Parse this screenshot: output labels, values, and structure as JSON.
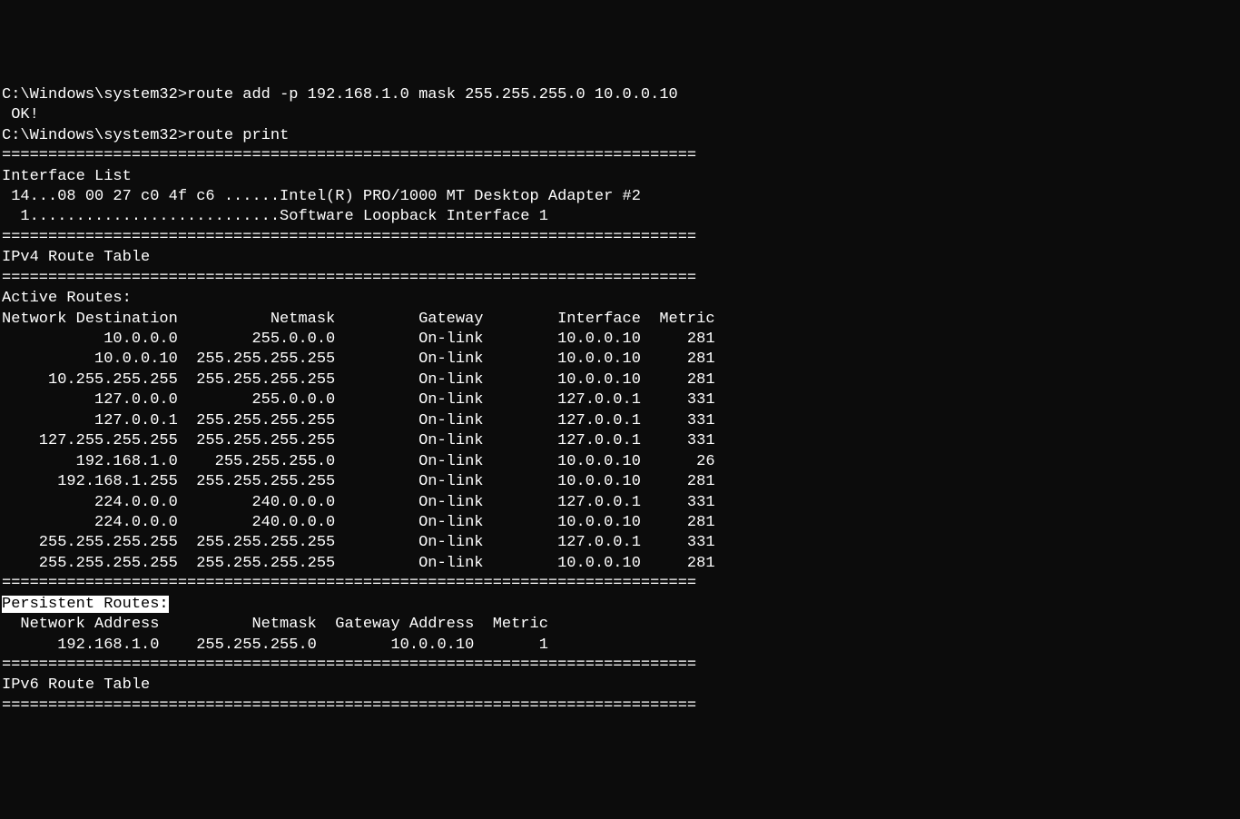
{
  "commands": [
    {
      "prompt": "C:\\Windows\\system32>",
      "cmd": "route add -p 192.168.1.0 mask 255.255.255.0 10.0.0.10"
    },
    {
      "prompt": "C:\\Windows\\system32>",
      "cmd": "route print"
    }
  ],
  "ok_line": " OK!",
  "separator": "===========================================================================",
  "interface_list": {
    "heading": "Interface List",
    "lines": [
      " 14...08 00 27 c0 4f c6 ......Intel(R) PRO/1000 MT Desktop Adapter #2",
      "  1...........................Software Loopback Interface 1"
    ]
  },
  "ipv4_heading": "IPv4 Route Table",
  "active_heading": "Active Routes:",
  "active_columns": [
    "Network Destination",
    "Netmask",
    "Gateway",
    "Interface",
    "Metric"
  ],
  "active_routes": [
    {
      "dest": "10.0.0.0",
      "mask": "255.0.0.0",
      "gw": "On-link",
      "iface": "10.0.0.10",
      "metric": "281"
    },
    {
      "dest": "10.0.0.10",
      "mask": "255.255.255.255",
      "gw": "On-link",
      "iface": "10.0.0.10",
      "metric": "281"
    },
    {
      "dest": "10.255.255.255",
      "mask": "255.255.255.255",
      "gw": "On-link",
      "iface": "10.0.0.10",
      "metric": "281"
    },
    {
      "dest": "127.0.0.0",
      "mask": "255.0.0.0",
      "gw": "On-link",
      "iface": "127.0.0.1",
      "metric": "331"
    },
    {
      "dest": "127.0.0.1",
      "mask": "255.255.255.255",
      "gw": "On-link",
      "iface": "127.0.0.1",
      "metric": "331"
    },
    {
      "dest": "127.255.255.255",
      "mask": "255.255.255.255",
      "gw": "On-link",
      "iface": "127.0.0.1",
      "metric": "331"
    },
    {
      "dest": "192.168.1.0",
      "mask": "255.255.255.0",
      "gw": "On-link",
      "iface": "10.0.0.10",
      "metric": "26"
    },
    {
      "dest": "192.168.1.255",
      "mask": "255.255.255.255",
      "gw": "On-link",
      "iface": "10.0.0.10",
      "metric": "281"
    },
    {
      "dest": "224.0.0.0",
      "mask": "240.0.0.0",
      "gw": "On-link",
      "iface": "127.0.0.1",
      "metric": "331"
    },
    {
      "dest": "224.0.0.0",
      "mask": "240.0.0.0",
      "gw": "On-link",
      "iface": "10.0.0.10",
      "metric": "281"
    },
    {
      "dest": "255.255.255.255",
      "mask": "255.255.255.255",
      "gw": "On-link",
      "iface": "127.0.0.1",
      "metric": "331"
    },
    {
      "dest": "255.255.255.255",
      "mask": "255.255.255.255",
      "gw": "On-link",
      "iface": "10.0.0.10",
      "metric": "281"
    }
  ],
  "persistent_heading": "Persistent Routes:",
  "persistent_columns": [
    "Network Address",
    "Netmask",
    "Gateway Address",
    "Metric"
  ],
  "persistent_routes": [
    {
      "addr": "192.168.1.0",
      "mask": "255.255.255.0",
      "gw": "10.0.0.10",
      "metric": "1"
    }
  ],
  "ipv6_heading": "IPv6 Route Table",
  "widths": {
    "active": {
      "dest": 19,
      "mask": 17,
      "gw": 16,
      "iface": 17,
      "metric": 8
    },
    "persistent": {
      "addr": 17,
      "mask": 17,
      "gw": 17,
      "metric": 8
    }
  }
}
